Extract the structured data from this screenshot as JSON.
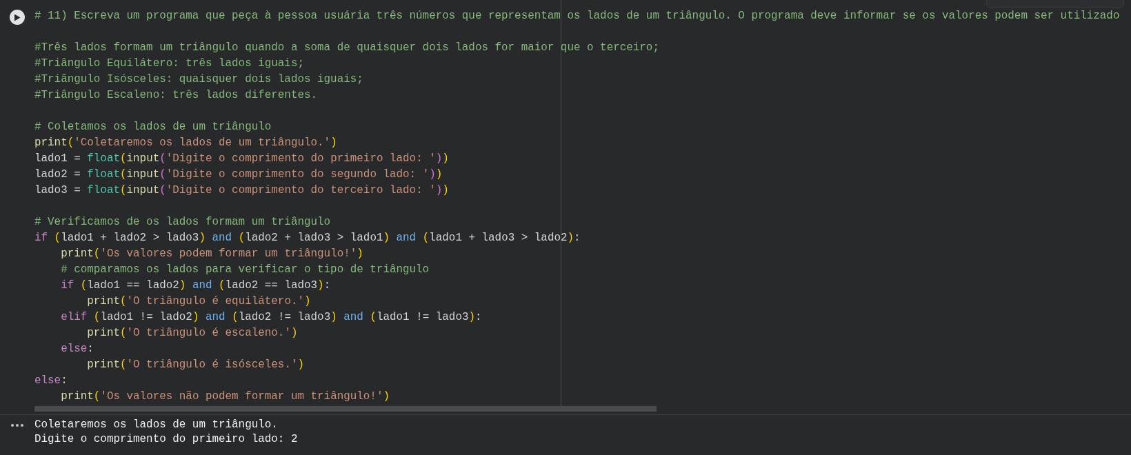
{
  "cell": {
    "code_blocks": [
      {
        "lines": [
          {
            "tokens": [
              {
                "kind": "comment",
                "text": "# 11) Escreva um programa que peça à pessoa usuária três números que representam os lados de um triângulo. O programa deve informar se os valores podem ser utilizado"
              }
            ]
          }
        ]
      },
      {
        "lines": [
          {
            "tokens": [
              {
                "kind": "comment",
                "text": "#Três lados formam um triângulo quando a soma de quaisquer dois lados for maior que o terceiro;"
              }
            ]
          },
          {
            "tokens": [
              {
                "kind": "comment",
                "text": "#Triângulo Equilátero: três lados iguais;"
              }
            ]
          },
          {
            "tokens": [
              {
                "kind": "comment",
                "text": "#Triângulo Isósceles: quaisquer dois lados iguais;"
              }
            ]
          },
          {
            "tokens": [
              {
                "kind": "comment",
                "text": "#Triângulo Escaleno: três lados diferentes."
              }
            ]
          }
        ]
      },
      {
        "lines": [
          {
            "tokens": [
              {
                "kind": "comment",
                "text": "# Coletamos os lados de um triângulo"
              }
            ]
          },
          {
            "tokens": [
              {
                "kind": "function",
                "text": "print"
              },
              {
                "kind": "paren",
                "text": "("
              },
              {
                "kind": "string",
                "text": "'Coletaremos os lados de um triângulo.'"
              },
              {
                "kind": "paren",
                "text": ")"
              }
            ]
          },
          {
            "tokens": [
              {
                "kind": "plain",
                "text": "lado1 = "
              },
              {
                "kind": "builtin",
                "text": "float"
              },
              {
                "kind": "paren",
                "text": "("
              },
              {
                "kind": "function",
                "text": "input"
              },
              {
                "kind": "paren2",
                "text": "("
              },
              {
                "kind": "string",
                "text": "'Digite o comprimento do primeiro lado: '"
              },
              {
                "kind": "paren2",
                "text": ")"
              },
              {
                "kind": "paren",
                "text": ")"
              }
            ]
          },
          {
            "tokens": [
              {
                "kind": "plain",
                "text": "lado2 = "
              },
              {
                "kind": "builtin",
                "text": "float"
              },
              {
                "kind": "paren",
                "text": "("
              },
              {
                "kind": "function",
                "text": "input"
              },
              {
                "kind": "paren2",
                "text": "("
              },
              {
                "kind": "string",
                "text": "'Digite o comprimento do segundo lado: '"
              },
              {
                "kind": "paren2",
                "text": ")"
              },
              {
                "kind": "paren",
                "text": ")"
              }
            ]
          },
          {
            "tokens": [
              {
                "kind": "plain",
                "text": "lado3 = "
              },
              {
                "kind": "builtin",
                "text": "float"
              },
              {
                "kind": "paren",
                "text": "("
              },
              {
                "kind": "function",
                "text": "input"
              },
              {
                "kind": "paren2",
                "text": "("
              },
              {
                "kind": "string",
                "text": "'Digite o comprimento do terceiro lado: '"
              },
              {
                "kind": "paren2",
                "text": ")"
              },
              {
                "kind": "paren",
                "text": ")"
              }
            ]
          }
        ]
      },
      {
        "lines": [
          {
            "tokens": [
              {
                "kind": "comment",
                "text": "# Verificamos de os lados formam um triângulo"
              }
            ]
          },
          {
            "tokens": [
              {
                "kind": "keyword",
                "text": "if "
              },
              {
                "kind": "paren",
                "text": "("
              },
              {
                "kind": "plain",
                "text": "lado1 + lado2 > lado3"
              },
              {
                "kind": "paren",
                "text": ")"
              },
              {
                "kind": "operator",
                "text": " and "
              },
              {
                "kind": "paren",
                "text": "("
              },
              {
                "kind": "plain",
                "text": "lado2 + lado3 > lado1"
              },
              {
                "kind": "paren",
                "text": ")"
              },
              {
                "kind": "operator",
                "text": " and "
              },
              {
                "kind": "paren",
                "text": "("
              },
              {
                "kind": "plain",
                "text": "lado1 + lado3 > lado2"
              },
              {
                "kind": "paren",
                "text": ")"
              },
              {
                "kind": "plain",
                "text": ":"
              }
            ],
            "children": [
              {
                "tokens": [
                  {
                    "kind": "function",
                    "text": "print"
                  },
                  {
                    "kind": "paren",
                    "text": "("
                  },
                  {
                    "kind": "string",
                    "text": "'Os valores podem formar um triângulo!'"
                  },
                  {
                    "kind": "paren",
                    "text": ")"
                  }
                ]
              },
              {
                "tokens": [
                  {
                    "kind": "comment",
                    "text": "# comparamos os lados para verificar o tipo de triângulo"
                  }
                ]
              },
              {
                "tokens": [
                  {
                    "kind": "keyword",
                    "text": "if "
                  },
                  {
                    "kind": "paren",
                    "text": "("
                  },
                  {
                    "kind": "plain",
                    "text": "lado1 == lado2"
                  },
                  {
                    "kind": "paren",
                    "text": ")"
                  },
                  {
                    "kind": "operator",
                    "text": " and "
                  },
                  {
                    "kind": "paren",
                    "text": "("
                  },
                  {
                    "kind": "plain",
                    "text": "lado2 == lado3"
                  },
                  {
                    "kind": "paren",
                    "text": ")"
                  },
                  {
                    "kind": "plain",
                    "text": ":"
                  }
                ],
                "children": [
                  {
                    "tokens": [
                      {
                        "kind": "function",
                        "text": "print"
                      },
                      {
                        "kind": "paren",
                        "text": "("
                      },
                      {
                        "kind": "string",
                        "text": "'O triângulo é equilátero.'"
                      },
                      {
                        "kind": "paren",
                        "text": ")"
                      }
                    ]
                  }
                ]
              },
              {
                "tokens": [
                  {
                    "kind": "keyword",
                    "text": "elif "
                  },
                  {
                    "kind": "paren",
                    "text": "("
                  },
                  {
                    "kind": "plain",
                    "text": "lado1 != lado2"
                  },
                  {
                    "kind": "paren",
                    "text": ")"
                  },
                  {
                    "kind": "operator",
                    "text": " and "
                  },
                  {
                    "kind": "paren",
                    "text": "("
                  },
                  {
                    "kind": "plain",
                    "text": "lado2 != lado3"
                  },
                  {
                    "kind": "paren",
                    "text": ")"
                  },
                  {
                    "kind": "operator",
                    "text": " and "
                  },
                  {
                    "kind": "paren",
                    "text": "("
                  },
                  {
                    "kind": "plain",
                    "text": "lado1 != lado3"
                  },
                  {
                    "kind": "paren",
                    "text": ")"
                  },
                  {
                    "kind": "plain",
                    "text": ":"
                  }
                ],
                "children": [
                  {
                    "tokens": [
                      {
                        "kind": "function",
                        "text": "print"
                      },
                      {
                        "kind": "paren",
                        "text": "("
                      },
                      {
                        "kind": "string",
                        "text": "'O triângulo é escaleno.'"
                      },
                      {
                        "kind": "paren",
                        "text": ")"
                      }
                    ]
                  }
                ]
              },
              {
                "tokens": [
                  {
                    "kind": "keyword",
                    "text": "else"
                  },
                  {
                    "kind": "plain",
                    "text": ":"
                  }
                ],
                "children": [
                  {
                    "tokens": [
                      {
                        "kind": "function",
                        "text": "print"
                      },
                      {
                        "kind": "paren",
                        "text": "("
                      },
                      {
                        "kind": "string",
                        "text": "'O triângulo é isósceles.'"
                      },
                      {
                        "kind": "paren",
                        "text": ")"
                      }
                    ]
                  }
                ]
              }
            ]
          },
          {
            "tokens": [
              {
                "kind": "keyword",
                "text": "else"
              },
              {
                "kind": "plain",
                "text": ":"
              }
            ],
            "children": [
              {
                "tokens": [
                  {
                    "kind": "function",
                    "text": "print"
                  },
                  {
                    "kind": "paren",
                    "text": "("
                  },
                  {
                    "kind": "string",
                    "text": "'Os valores não podem formar um triângulo!'"
                  },
                  {
                    "kind": "paren",
                    "text": ")"
                  }
                ]
              }
            ]
          }
        ]
      }
    ],
    "output_lines": [
      "Coletaremos os lados de um triângulo.",
      "Digite o comprimento do primeiro lado: 2"
    ]
  }
}
